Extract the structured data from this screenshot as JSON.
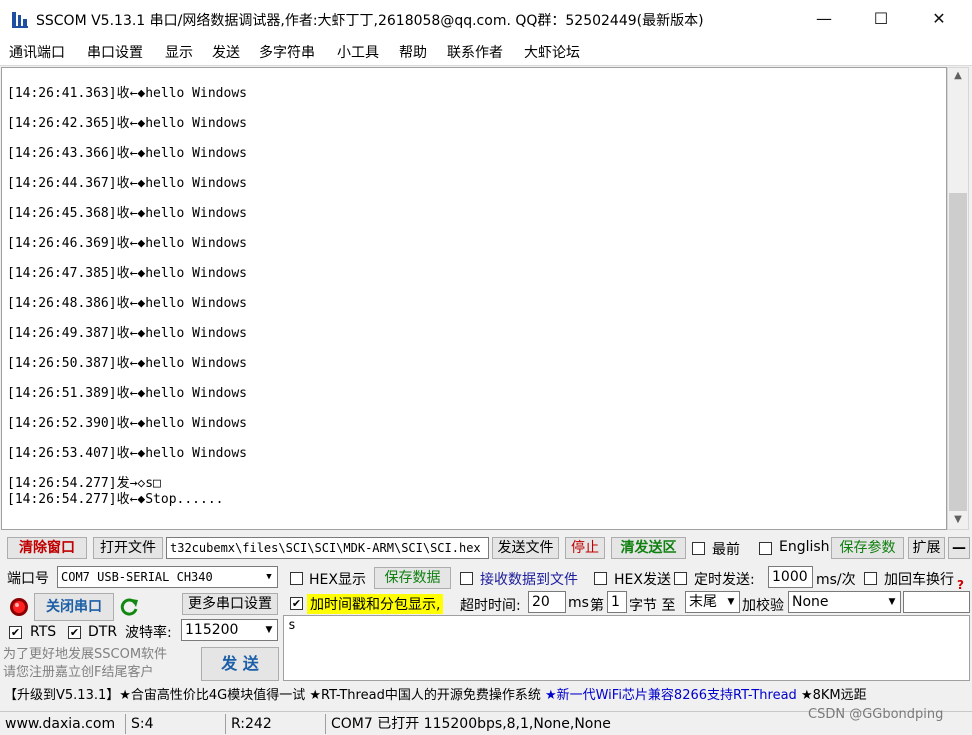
{
  "window": {
    "title": "SSCOM V5.13.1 串口/网络数据调试器,作者:大虾丁丁,2618058@qq.com. QQ群：52502449(最新版本)",
    "minimize": "—",
    "maximize": "☐",
    "close": "✕"
  },
  "menu": [
    "通讯端口",
    "串口设置",
    "显示",
    "发送",
    "多字符串",
    "小工具",
    "帮助",
    "联系作者",
    "大虾论坛"
  ],
  "receive": {
    "lines": [
      "[14:26:41.363]收←◆hello Windows",
      "[14:26:42.365]收←◆hello Windows",
      "[14:26:43.366]收←◆hello Windows",
      "[14:26:44.367]收←◆hello Windows",
      "[14:26:45.368]收←◆hello Windows",
      "[14:26:46.369]收←◆hello Windows",
      "[14:26:47.385]收←◆hello Windows",
      "[14:26:48.386]收←◆hello Windows",
      "[14:26:49.387]收←◆hello Windows",
      "[14:26:50.387]收←◆hello Windows",
      "[14:26:51.389]收←◆hello Windows",
      "[14:26:52.390]收←◆hello Windows",
      "[14:26:53.407]收←◆hello Windows",
      "[14:26:54.277]发→◇s□",
      "[14:26:54.277]收←◆Stop......"
    ]
  },
  "toolbar": {
    "clear_window": "清除窗口",
    "open_file": "打开文件",
    "file_path": "t32cubemx\\files\\SCI\\SCI\\MDK-ARM\\SCI\\SCI.hex",
    "send_file": "发送文件",
    "stop": "停止",
    "clear_send": "清发送区",
    "topmost": "最前",
    "english": "English",
    "save_params": "保存参数",
    "expand": "扩展",
    "collapse": "—"
  },
  "port": {
    "port_label": "端口号",
    "port_value": "COM7 USB-SERIAL CH340",
    "close_port": "关闭串口",
    "more_settings": "更多串口设置",
    "rts": "RTS",
    "dtr": "DTR",
    "baud_label": "波特率:",
    "baud_value": "115200"
  },
  "options": {
    "hex_display": "HEX显示",
    "save_data": "保存数据",
    "recv_to_file": "接收数据到文件",
    "hex_send": "HEX发送",
    "timed_send": "定时发送:",
    "interval": "1000",
    "interval_unit": "ms/次",
    "append_newline": "加回车换行",
    "timestamp": "加时间戳和分包显示,",
    "timeout_label": "超时时间:",
    "timeout_value": "20",
    "timeout_unit": "ms",
    "byte_prefix": "第",
    "byte_value": "1",
    "byte_label": "字节 至",
    "byte_end": "末尾",
    "checksum_label": "加校验",
    "checksum_value": "None"
  },
  "send": {
    "content": "s",
    "promo_line1": "为了更好地发展SSCOM软件",
    "promo_line2": "请您注册嘉立创F结尾客户",
    "send_button": "发 送"
  },
  "notice": "【升级到V5.13.1】★合宙高性价比4G模块值得一试 ★RT-Thread中国人的开源免费操作系统 ★新一代WiFi芯片兼容8266支持RT-Thread ★8KM远距",
  "status": {
    "website": "www.daxia.com",
    "sent": "S:4",
    "received": "R:242",
    "port_status": "COM7 已打开  115200bps,8,1,None,None"
  },
  "watermark": "CSDN @GGbondping",
  "colors": {
    "notice_blue": "#0000cc",
    "button_red": "#c00000",
    "button_green": "#108010",
    "highlight_yellow": "#ffff00"
  }
}
